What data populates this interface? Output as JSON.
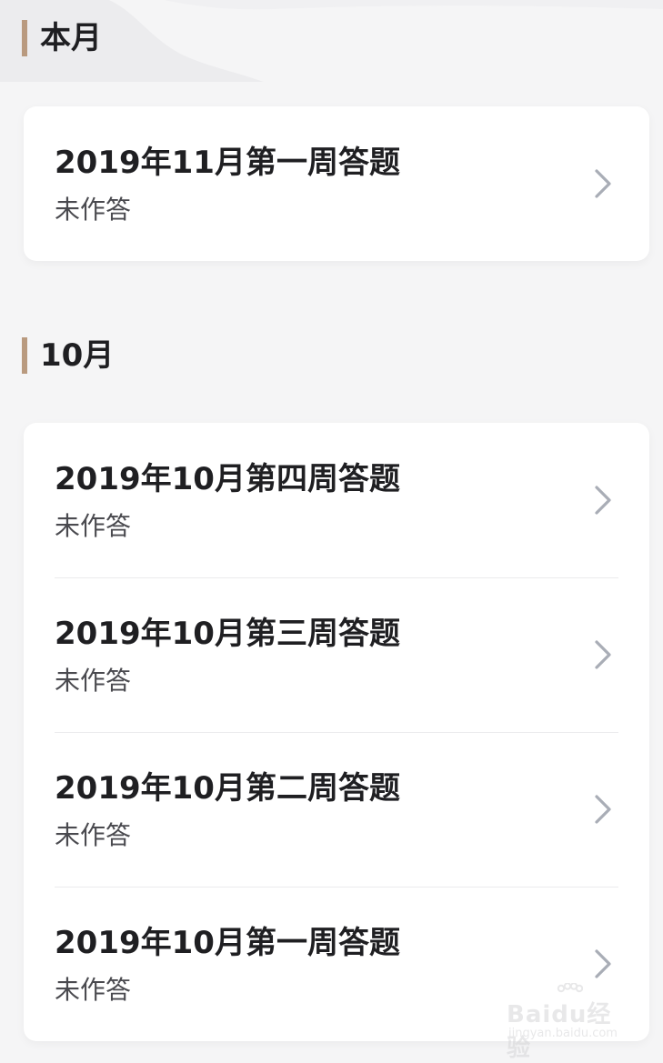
{
  "sections": [
    {
      "title": "本月",
      "items": [
        {
          "title": "2019年11月第一周答题",
          "status": "未作答"
        }
      ]
    },
    {
      "title": "10月",
      "items": [
        {
          "title": "2019年10月第四周答题",
          "status": "未作答"
        },
        {
          "title": "2019年10月第三周答题",
          "status": "未作答"
        },
        {
          "title": "2019年10月第二周答题",
          "status": "未作答"
        },
        {
          "title": "2019年10月第一周答题",
          "status": "未作答"
        }
      ]
    }
  ],
  "watermark": {
    "brand": "Baidu经验",
    "url": "jingyan.baidu.com"
  },
  "colors": {
    "accent_bar": "#b99a7f",
    "chevron": "#a9adb6",
    "background": "#f5f5f6",
    "card": "#ffffff"
  }
}
